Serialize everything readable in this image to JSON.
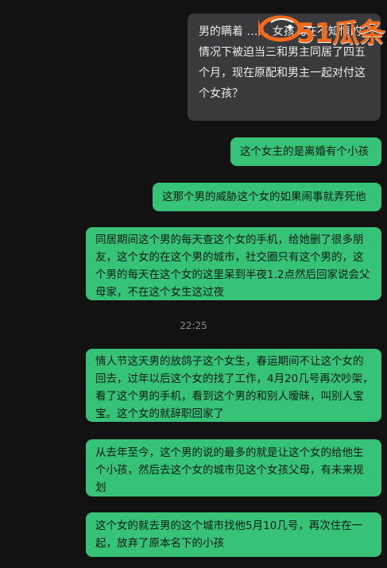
{
  "messages": [
    {
      "side": "right",
      "style": "dark",
      "text": "男的瞒着 …… 女孩儿在不知情的情况下被迫当三和男主同居了四五个月，现在原配和男主一起对付这个女孩？"
    },
    {
      "side": "right",
      "style": "green",
      "text": "这个女主的是离婚有个小孩"
    },
    {
      "side": "right",
      "style": "green",
      "text": "这那个男的威胁这个女的如果闹事就弄死他"
    },
    {
      "side": "right",
      "style": "green",
      "text": "同居期间这个男的每天查这个女的手机，给她删了很多朋友，这个女的在这个男的城市，社交圈只有这个男的，这个男的每天在这个女的这里呆到半夜1.2点然后回家说会父母家，不在这个女生这过夜"
    },
    {
      "side": "right",
      "style": "green",
      "text": "情人节这天男的放鸽子这个女生，春运期间不让这个女的回去，过年以后这个女的找了工作，4月20几号再次吵架，看了这个男的手机，看到这个男的和别人暧昧，叫别人宝宝。这个女的就辞职回家了"
    },
    {
      "side": "right",
      "style": "green",
      "text": "从去年至今，这个男的说的最多的就是让这个女的给他生个小孩，然后去这个女的城市见这个女孩父母，有未来规划"
    },
    {
      "side": "right",
      "style": "green",
      "text": "这个女的就去男的这个城市找他5月10几号，再次住在一起，放弃了原本名下的小孩"
    }
  ],
  "timestamp": "22:25",
  "watermark": {
    "logo_text": "51瓜条",
    "color": "#f36a1c"
  },
  "colors": {
    "background": "#121212",
    "green_bubble": "#36c277",
    "dark_bubble": "#3a3a3c"
  }
}
